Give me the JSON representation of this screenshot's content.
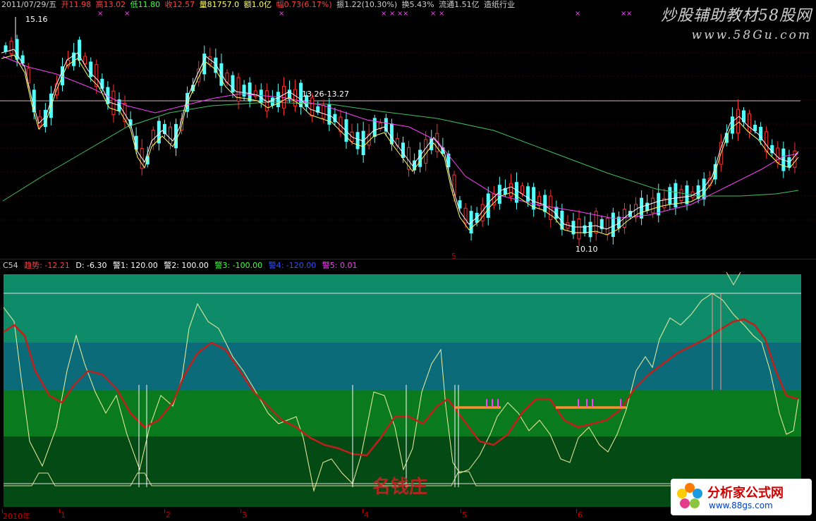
{
  "header": {
    "date": "2011/07/29/五",
    "open": "开11.98",
    "high": "高13.02",
    "low": "低11.80",
    "close": "收12.57",
    "volume": "量81757.0",
    "amount": "额1.0亿",
    "change": "幅0.73(6.17%)",
    "amplitude": "振1.22(10.30%)",
    "turnover": "换5.43%",
    "float": "流通1.51亿",
    "industry": "造纸行业"
  },
  "price_chart": {
    "high_label": "15.16",
    "low_label": "10.10",
    "mid_label": "13.26-13.27",
    "marker_label": "5"
  },
  "indicator": {
    "name": "C54",
    "trend": "趋势: -12.21",
    "d": "D: -6.30",
    "w1": "警1: 120.00",
    "w2": "警2: 100.00",
    "w3": "警3: -100.00",
    "w4": "警4: -120.00",
    "w5": "警5: 0.01"
  },
  "time_axis": {
    "labels": [
      "2010年",
      "1",
      "2",
      "3",
      "4",
      "5",
      "6"
    ]
  },
  "watermark": {
    "title": "炒股辅助教材58股网",
    "site": "www.58Gu.com"
  },
  "logo": {
    "name": "分析家公式网",
    "url": "www.88gs.com",
    "center_brand": "名钱庄"
  },
  "colors": {
    "up": "#ff3030",
    "down": "#54ffff",
    "ma5": "#ffffff",
    "ma10": "#ffff66",
    "ma20": "#ff40ff",
    "ma60": "#40c060",
    "trend": "#c0201a",
    "d": "#f0f0a0",
    "orange": "#ff8c30"
  }
}
